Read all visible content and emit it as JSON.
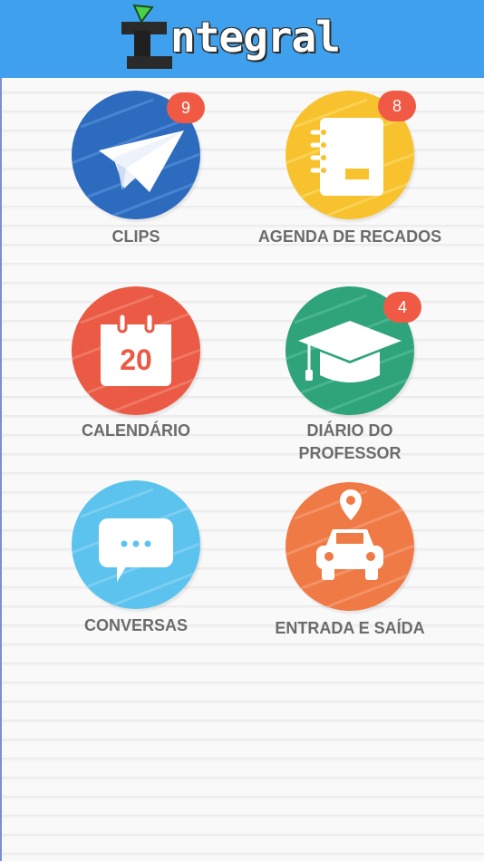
{
  "app": {
    "logo_text": "ntegral"
  },
  "colors": {
    "header": "#3fa1ee",
    "clips": "#2d6bbf",
    "agenda": "#f8c22e",
    "calendario": "#ea5a45",
    "diario": "#2fa37a",
    "conversas": "#5cc3ee",
    "entrada": "#f07a46",
    "badge": "#f05a44"
  },
  "tiles": [
    {
      "label": "CLIPS",
      "icon": "paper-plane-icon",
      "badge": "9"
    },
    {
      "label": "AGENDA DE RECADOS",
      "icon": "notebook-icon",
      "badge": "8"
    },
    {
      "label": "CALENDÁRIO",
      "icon": "calendar-icon",
      "calendar_day": "20"
    },
    {
      "label": "DIÁRIO DO\nPROFESSOR",
      "icon": "graduation-cap-icon",
      "badge": "4"
    },
    {
      "label": "CONVERSAS",
      "icon": "chat-bubble-icon"
    },
    {
      "label": "ENTRADA E SAÍDA",
      "icon": "car-location-icon"
    }
  ]
}
